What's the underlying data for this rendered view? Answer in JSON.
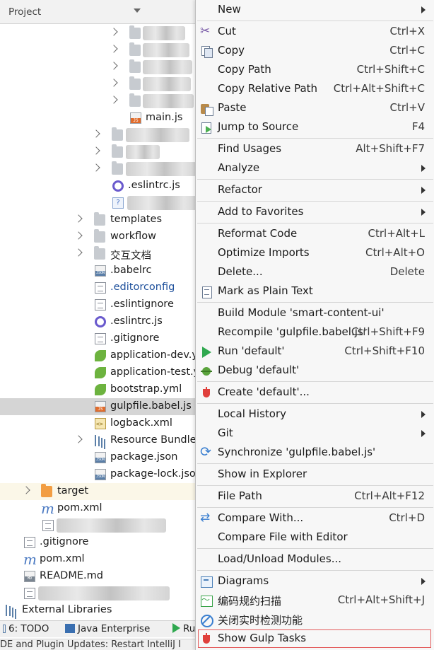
{
  "project_panel": {
    "title": "Project",
    "rows": [
      {
        "label": ""
      },
      {
        "label": ""
      },
      {
        "label": ""
      },
      {
        "label": ""
      },
      {
        "label": ""
      },
      {
        "label": "main.js"
      },
      {
        "label": ""
      },
      {
        "label": ""
      },
      {
        "label": ""
      },
      {
        "label": ".eslintrc.js"
      },
      {
        "label": ""
      },
      {
        "label": "templates"
      },
      {
        "label": "workflow"
      },
      {
        "label": "交互文档"
      },
      {
        "label": ".babelrc"
      },
      {
        "label": ".editorconfig"
      },
      {
        "label": ".eslintignore"
      },
      {
        "label": ".eslintrc.js"
      },
      {
        "label": ".gitignore"
      },
      {
        "label": "application-dev.y"
      },
      {
        "label": "application-test.y"
      },
      {
        "label": "bootstrap.yml"
      },
      {
        "label": "gulpfile.babel.js"
      },
      {
        "label": "logback.xml"
      },
      {
        "label": "Resource Bundle"
      },
      {
        "label": "package.json"
      },
      {
        "label": "package-lock.json"
      },
      {
        "label": "target"
      },
      {
        "label": "pom.xml"
      },
      {
        "label": ""
      },
      {
        "label": ".gitignore"
      },
      {
        "label": "pom.xml"
      },
      {
        "label": "README.md"
      },
      {
        "label": ""
      },
      {
        "label": "External Libraries"
      }
    ]
  },
  "tool_tabs": {
    "todo": "6: TODO",
    "java_enterprise": "Java Enterprise",
    "run": "Ru"
  },
  "status_bar": {
    "text": "DE and Plugin Updates: Restart IntelliJ I"
  },
  "context_menu": {
    "items": [
      {
        "label": "New",
        "shortcut": ""
      },
      {
        "label": "Cut",
        "shortcut": "Ctrl+X"
      },
      {
        "label": "Copy",
        "shortcut": "Ctrl+C"
      },
      {
        "label": "Copy Path",
        "shortcut": "Ctrl+Shift+C"
      },
      {
        "label": "Copy Relative Path",
        "shortcut": "Ctrl+Alt+Shift+C"
      },
      {
        "label": "Paste",
        "shortcut": "Ctrl+V"
      },
      {
        "label": "Jump to Source",
        "shortcut": "F4"
      },
      {
        "label": "Find Usages",
        "shortcut": "Alt+Shift+F7"
      },
      {
        "label": "Analyze",
        "shortcut": ""
      },
      {
        "label": "Refactor",
        "shortcut": ""
      },
      {
        "label": "Add to Favorites",
        "shortcut": ""
      },
      {
        "label": "Reformat Code",
        "shortcut": "Ctrl+Alt+L"
      },
      {
        "label": "Optimize Imports",
        "shortcut": "Ctrl+Alt+O"
      },
      {
        "label": "Delete...",
        "shortcut": "Delete"
      },
      {
        "label": "Mark as Plain Text",
        "shortcut": ""
      },
      {
        "label": "Build Module 'smart-content-ui'",
        "shortcut": ""
      },
      {
        "label": "Recompile 'gulpfile.babel.js'",
        "shortcut": "Ctrl+Shift+F9"
      },
      {
        "label": "Run 'default'",
        "shortcut": "Ctrl+Shift+F10"
      },
      {
        "label": "Debug 'default'",
        "shortcut": ""
      },
      {
        "label": "Create 'default'...",
        "shortcut": ""
      },
      {
        "label": "Local History",
        "shortcut": ""
      },
      {
        "label": "Git",
        "shortcut": ""
      },
      {
        "label": "Synchronize 'gulpfile.babel.js'",
        "shortcut": ""
      },
      {
        "label": "Show in Explorer",
        "shortcut": ""
      },
      {
        "label": "File Path",
        "shortcut": "Ctrl+Alt+F12"
      },
      {
        "label": "Compare With...",
        "shortcut": "Ctrl+D"
      },
      {
        "label": "Compare File with Editor",
        "shortcut": ""
      },
      {
        "label": "Load/Unload Modules...",
        "shortcut": ""
      },
      {
        "label": "Diagrams",
        "shortcut": ""
      },
      {
        "label": "编码规约扫描",
        "shortcut": "Ctrl+Alt+Shift+J"
      },
      {
        "label": "关闭实时检测功能",
        "shortcut": ""
      },
      {
        "label": "Show Gulp Tasks",
        "shortcut": ""
      }
    ]
  }
}
